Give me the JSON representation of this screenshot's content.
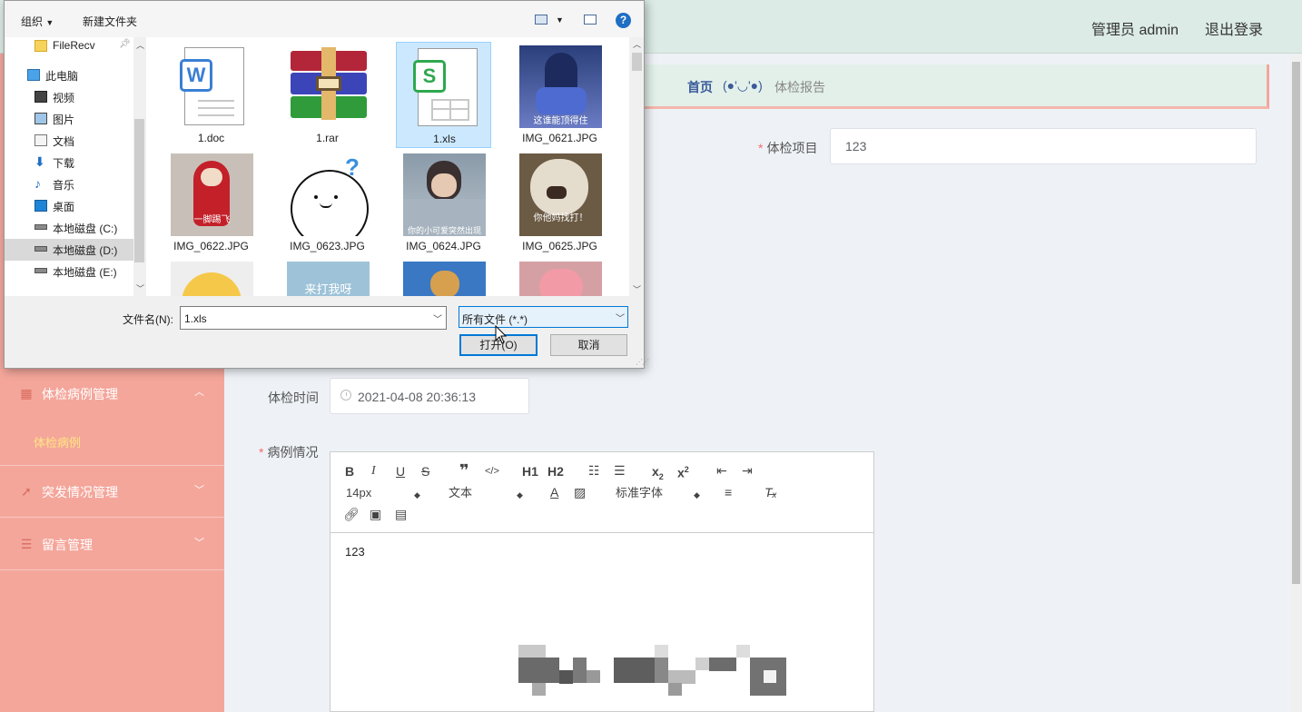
{
  "topbar": {
    "user": "管理员 admin",
    "logout": "退出登录"
  },
  "breadcrumb": {
    "home": "首页",
    "face": "(●'◡'●)",
    "current": "体检报告"
  },
  "sidebar": {
    "groups": [
      {
        "label": "体检病例管理",
        "icon": "grid-icon"
      },
      {
        "label": "突发情况管理",
        "icon": "navigation-icon"
      },
      {
        "label": "留言管理",
        "icon": "list-icon"
      }
    ],
    "active_sub": "体检病例"
  },
  "form": {
    "item_label": "体检项目",
    "item_value": "123",
    "time_label": "体检时间",
    "time_value": "2021-04-08 20:36:13",
    "case_label": "病例情况"
  },
  "editor": {
    "size": "14px",
    "text_style": "文本",
    "font": "标准字体",
    "content": "123",
    "h1": "H1",
    "h2": "H2"
  },
  "dialog": {
    "cmd_organize": "组织",
    "cmd_new_folder": "新建文件夹",
    "help": "?",
    "nav": [
      "FileRecv",
      "此电脑",
      "视频",
      "图片",
      "文档",
      "下载",
      "音乐",
      "桌面",
      "本地磁盘 (C:)",
      "本地磁盘 (D:)",
      "本地磁盘 (E:)"
    ],
    "files": [
      "1.doc",
      "1.rar",
      "1.xls",
      "IMG_0621.JPG",
      "IMG_0622.JPG",
      "IMG_0623.JPG",
      "IMG_0624.JPG",
      "IMG_0625.JPG"
    ],
    "thumb_texts": {
      "img0621": "这谁能顶得住",
      "img0622": "一脚踢飞",
      "img0624": "你的小可爱突然出现",
      "img0625": "你他妈找打！",
      "row3b": "来打我呀"
    },
    "filename_label": "文件名(N):",
    "filename_value": "1.xls",
    "filter": "所有文件 (*.*)",
    "open": "打开(O)",
    "cancel": "取消"
  }
}
